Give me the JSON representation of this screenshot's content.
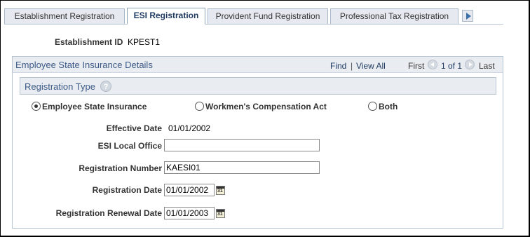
{
  "tabs": [
    {
      "label": "Establishment Registration",
      "active": false
    },
    {
      "label": "ESI Registration",
      "active": true
    },
    {
      "label": "Provident Fund Registration",
      "active": false
    },
    {
      "label": "Professional Tax Registration",
      "active": false
    }
  ],
  "establishment": {
    "label": "Establishment ID",
    "value": "KPEST1"
  },
  "section": {
    "title": "Employee State Insurance Details",
    "nav": {
      "find": "Find",
      "separator": "|",
      "view_all": "View All",
      "first": "First",
      "range": "1 of 1",
      "last": "Last"
    }
  },
  "registration_type": {
    "title": "Registration Type",
    "help": "?",
    "options": [
      {
        "label": "Employee State Insurance",
        "selected": true
      },
      {
        "label": "Workmen's Compensation Act",
        "selected": false
      },
      {
        "label": "Both",
        "selected": false
      }
    ]
  },
  "fields": {
    "effective_date": {
      "label": "Effective Date",
      "value": "01/01/2002"
    },
    "esi_local_office": {
      "label": "ESI Local Office",
      "value": ""
    },
    "registration_number": {
      "label": "Registration Number",
      "value": "KAESI01"
    },
    "registration_date": {
      "label": "Registration Date",
      "value": "01/01/2002"
    },
    "renewal_date": {
      "label": "Registration Renewal Date",
      "value": "01/01/2003"
    }
  }
}
